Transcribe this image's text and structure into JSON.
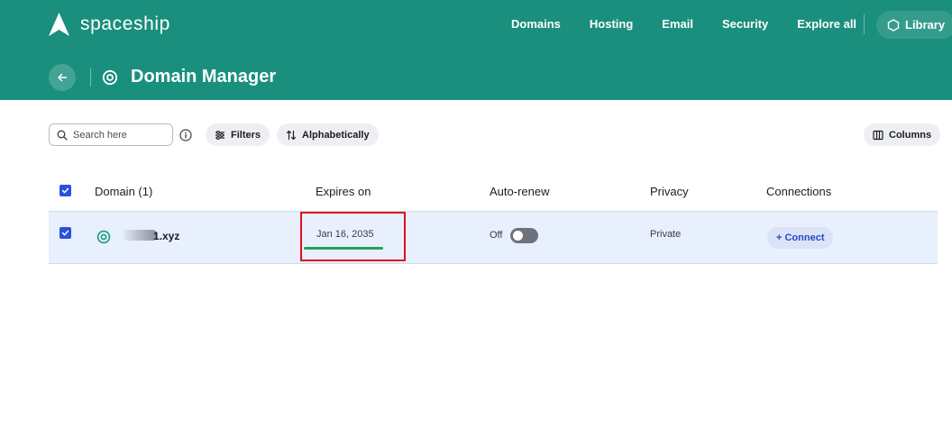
{
  "brand": {
    "name": "spaceship",
    "logo_icon": "spaceship-logo-icon"
  },
  "nav": {
    "items": [
      {
        "label": "Domains"
      },
      {
        "label": "Hosting"
      },
      {
        "label": "Email"
      },
      {
        "label": "Security"
      },
      {
        "label": "Explore all"
      }
    ],
    "library_label": "Library",
    "library_icon": "hexagon-icon"
  },
  "page": {
    "title": "Domain Manager",
    "back_icon": "arrow-left-icon",
    "title_icon": "domain-target-icon"
  },
  "toolbar": {
    "search_placeholder": "Search here",
    "filters_label": "Filters",
    "sort_label": "Alphabetically",
    "columns_label": "Columns"
  },
  "table": {
    "headers": {
      "domain": "Domain (1)",
      "expires": "Expires on",
      "autorenew": "Auto-renew",
      "privacy": "Privacy",
      "connections": "Connections"
    },
    "rows": [
      {
        "domain": "1.xyz",
        "expires": "Jan 16, 2035",
        "autorenew_label": "Off",
        "autorenew_on": false,
        "privacy": "Private",
        "connect_label": "+ Connect",
        "selected": true
      }
    ]
  },
  "colors": {
    "header_bg": "#1a8f7d",
    "accent_blue": "#2b4fe0",
    "row_selected_bg": "#e7f0fc",
    "highlight_red": "#e0101a",
    "expiry_bar_green": "#27a152"
  }
}
